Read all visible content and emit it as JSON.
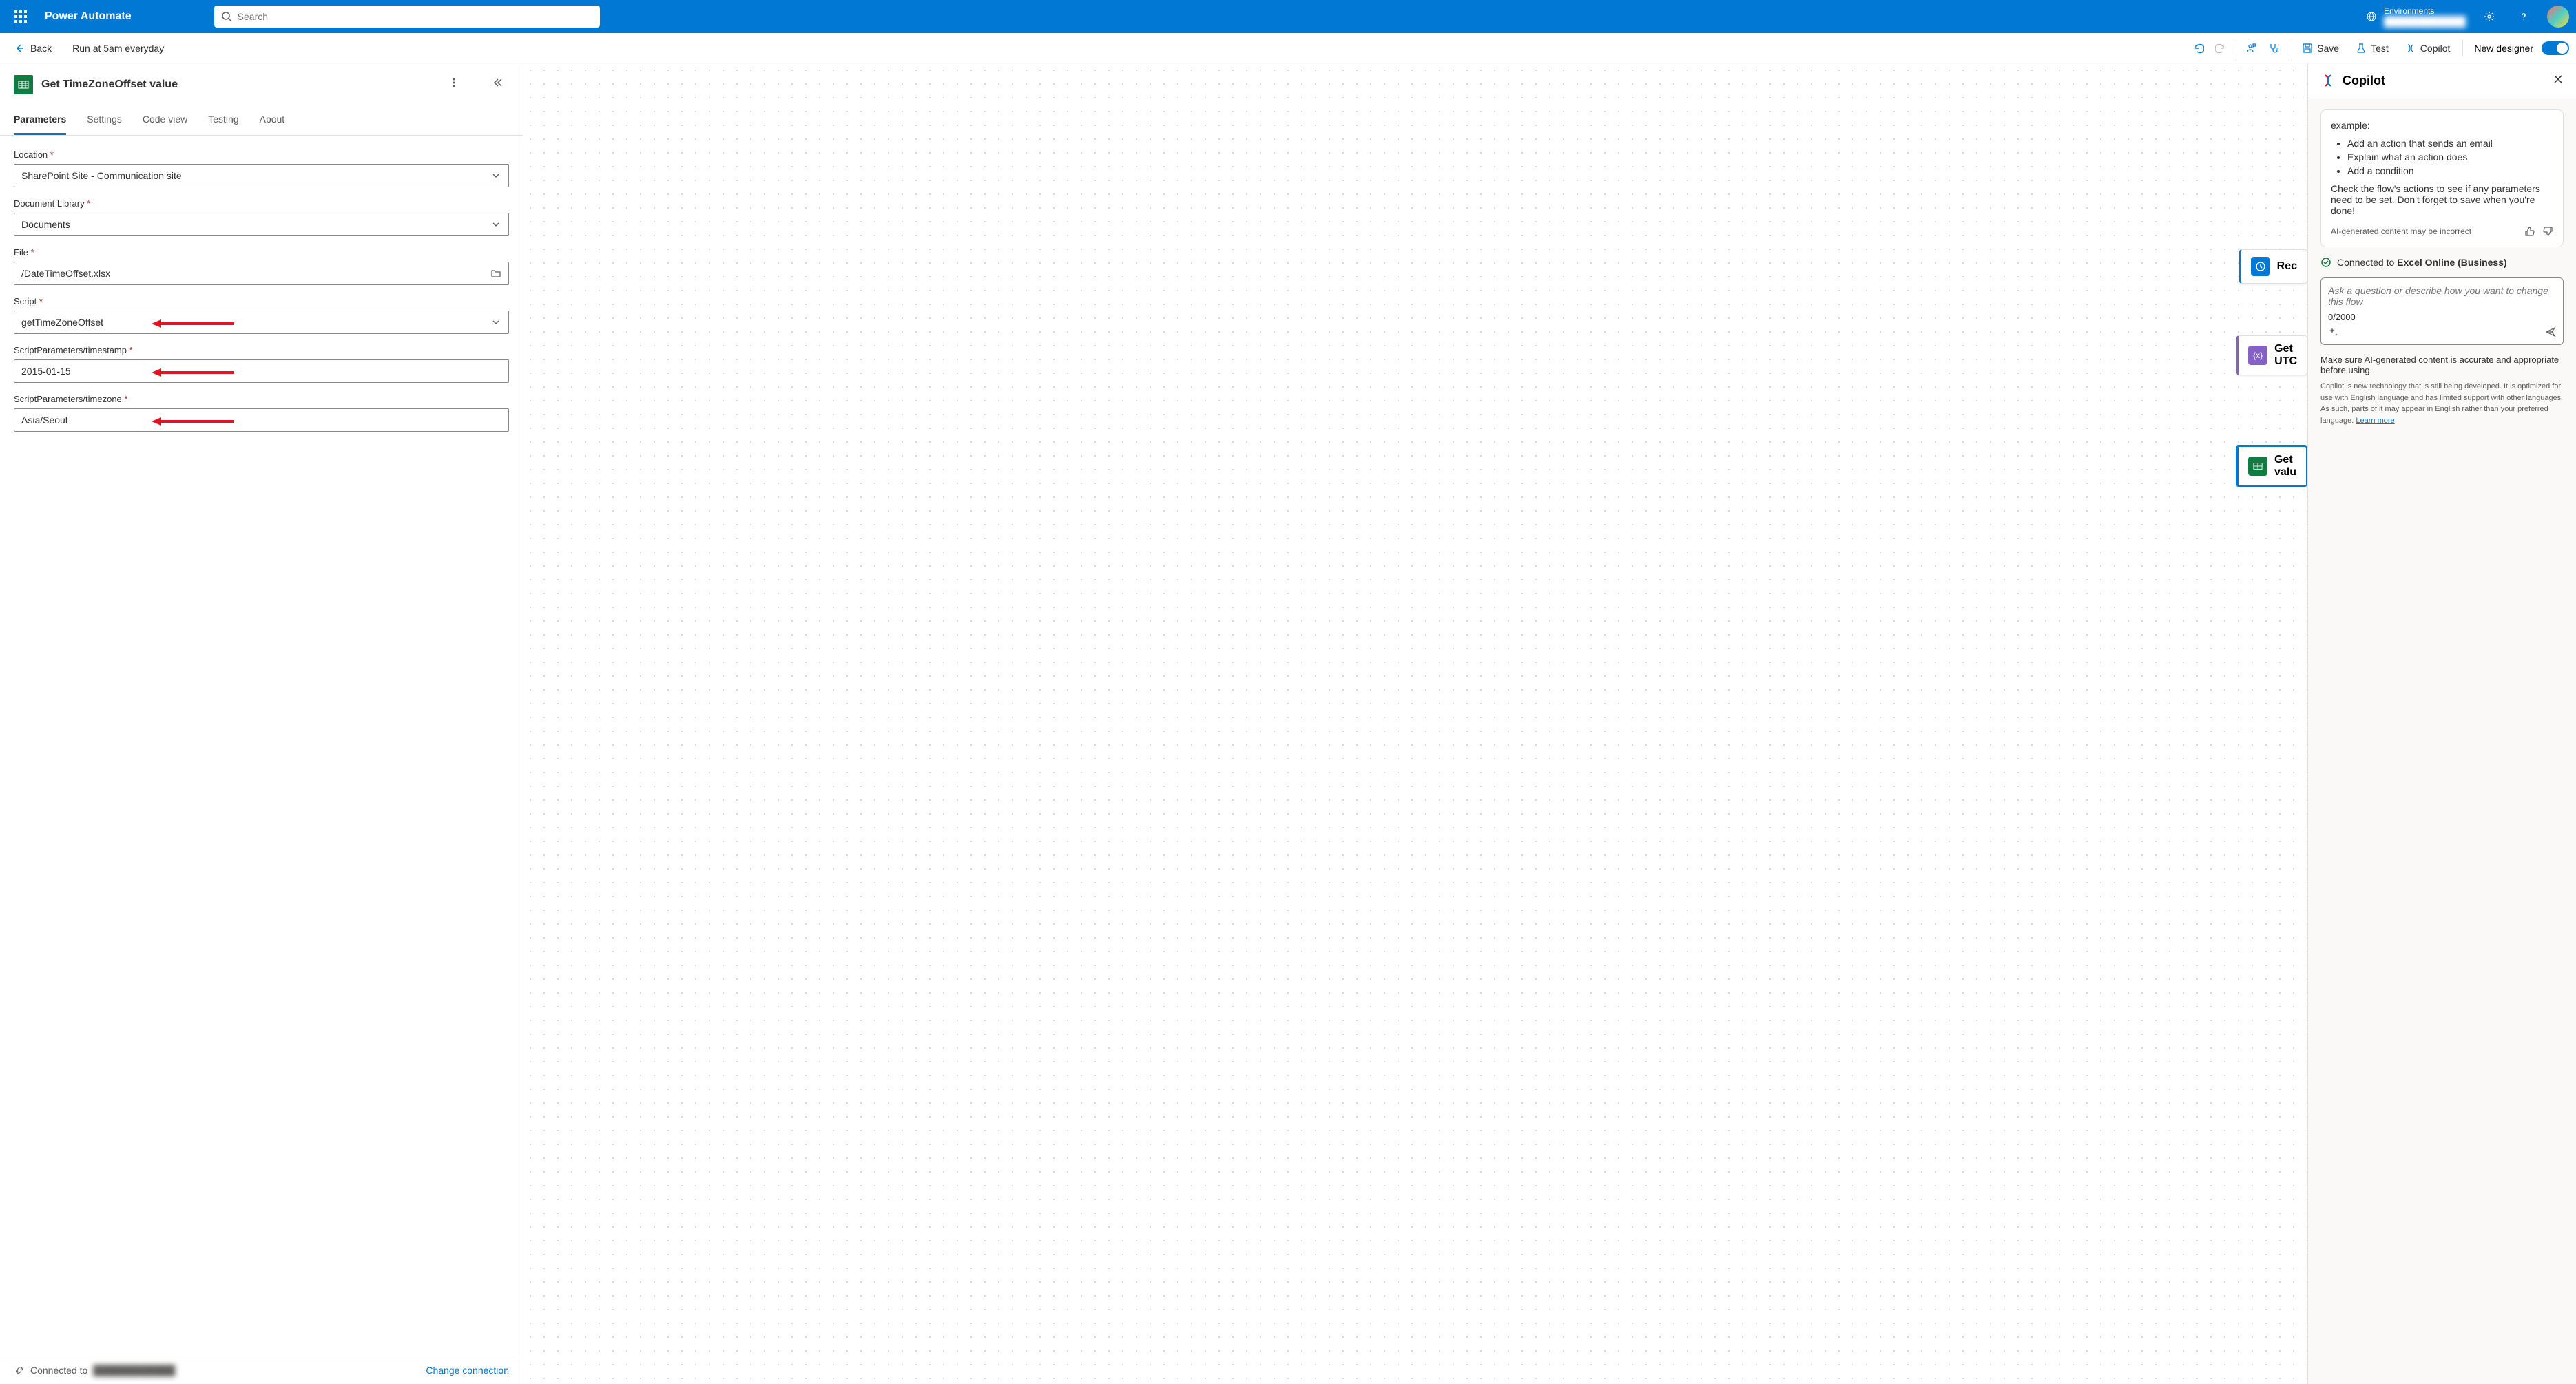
{
  "header": {
    "app_name": "Power Automate",
    "search_placeholder": "Search",
    "environments_label": "Environments"
  },
  "toolbar": {
    "back": "Back",
    "flow_name": "Run at 5am everyday",
    "save": "Save",
    "test": "Test",
    "copilot": "Copilot",
    "new_designer": "New designer"
  },
  "panel": {
    "title": "Get TimeZoneOffset value",
    "tabs": [
      "Parameters",
      "Settings",
      "Code view",
      "Testing",
      "About"
    ],
    "active_tab": 0,
    "fields": {
      "location": {
        "label": "Location",
        "value": "SharePoint Site - Communication site"
      },
      "doclib": {
        "label": "Document Library",
        "value": "Documents"
      },
      "file": {
        "label": "File",
        "value": "/DateTimeOffset.xlsx"
      },
      "script": {
        "label": "Script",
        "value": "getTimeZoneOffset"
      },
      "timestamp": {
        "label": "ScriptParameters/timestamp",
        "value": "2015-01-15"
      },
      "timezone": {
        "label": "ScriptParameters/timezone",
        "value": "Asia/Seoul"
      }
    },
    "footer": {
      "connected_to": "Connected to",
      "change": "Change connection"
    }
  },
  "canvas": {
    "card1": "Rec",
    "card2_line1": "Get",
    "card2_line2": "UTC",
    "card3_line1": "Get",
    "card3_line2": "valu"
  },
  "copilot": {
    "title": "Copilot",
    "intro": "example:",
    "bullets": [
      "Add an action that sends an email",
      "Explain what an action does",
      "Add a condition"
    ],
    "check_text": "Check the flow's actions to see if any parameters need to be set. Don't forget to save when you're done!",
    "ai_notice": "AI-generated content may be incorrect",
    "connected_prefix": "Connected to ",
    "connected_strong": "Excel Online (Business)",
    "input_placeholder": "Ask a question or describe how you want to change this flow",
    "char_count": "0/2000",
    "disclaimer": "Make sure AI-generated content is accurate and appropriate before using.",
    "fine_print": "Copilot is new technology that is still being developed. It is optimized for use with English language and has limited support with other languages. As such, parts of it may appear in English rather than your preferred language. ",
    "learn_more": "Learn more"
  }
}
